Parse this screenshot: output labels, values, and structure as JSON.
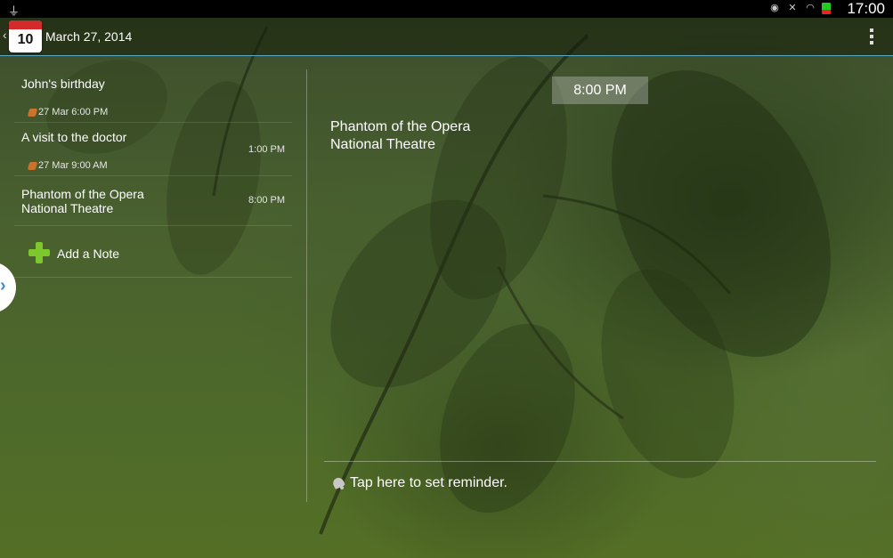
{
  "status_bar": {
    "usb_icon": "usb-icon",
    "icons": [
      "eye-icon",
      "mute-icon",
      "wifi-icon",
      "battery-icon"
    ],
    "clock": "17:00"
  },
  "action_bar": {
    "calendar_day": "10",
    "title": "March 27, 2014",
    "overflow_icon": "overflow-menu-icon"
  },
  "notes": [
    {
      "title": "John's birthday",
      "time": "",
      "reminder": "27 Mar 6:00 PM"
    },
    {
      "title": "A visit to the doctor",
      "time": "1:00 PM",
      "reminder": "27 Mar 9:00 AM"
    },
    {
      "title": "Phantom of the Opera\nNational Theatre",
      "time": "8:00 PM",
      "reminder": ""
    }
  ],
  "add_note_label": "Add a Note",
  "detail": {
    "time": "8:00 PM",
    "body": "Phantom of the Opera\nNational Theatre",
    "reminder_prompt": "Tap here to set reminder."
  },
  "colors": {
    "accent_line": "#5aa7c4",
    "add_icon": "#7cc72c",
    "calendar_red": "#d32b2b"
  }
}
